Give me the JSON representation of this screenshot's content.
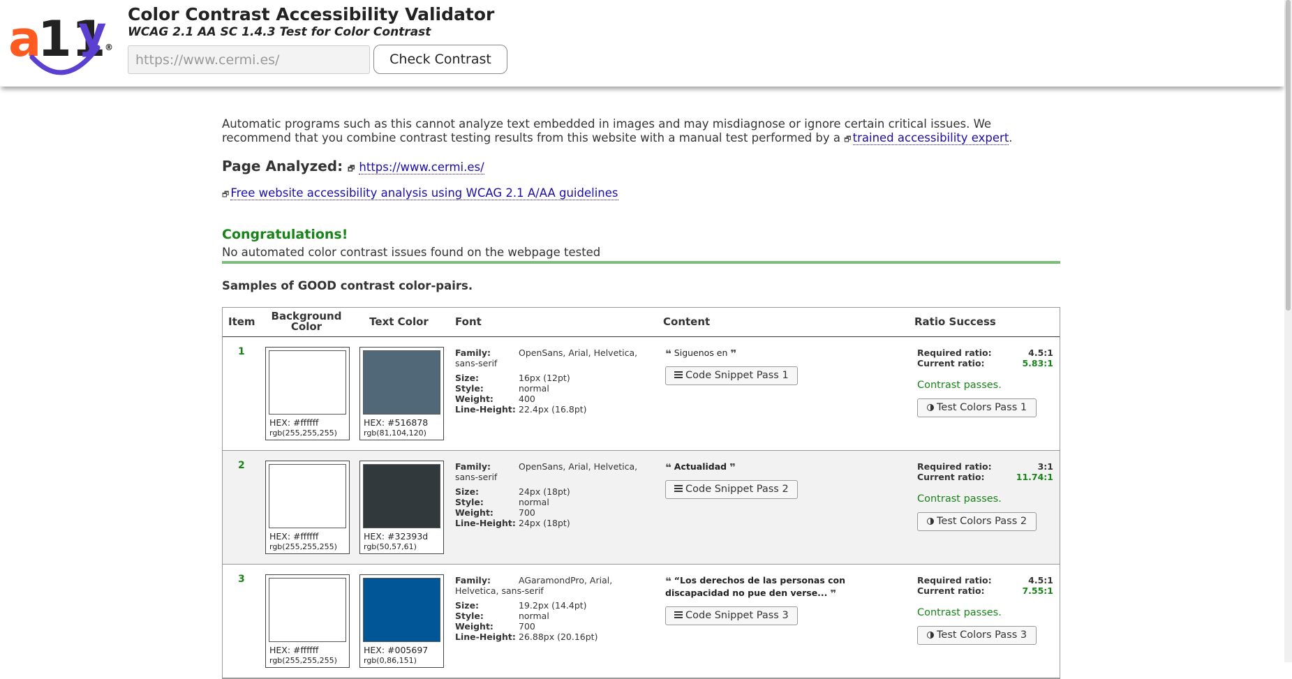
{
  "header": {
    "logo_text": "a11y",
    "logo_mark": "®",
    "title": "Color Contrast Accessibility Validator",
    "subtitle": "WCAG 2.1 AA SC 1.4.3 Test for Color Contrast",
    "url_placeholder": "https://www.cermi.es/",
    "check_button": "Check Contrast"
  },
  "notice": {
    "text": "Automatic programs such as this cannot analyze text embedded in images and may misdiagnose or ignore certain critical issues. We recommend that you combine contrast testing results from this website with a manual test performed by a ",
    "expert_link": "trained accessibility expert",
    "end": "."
  },
  "page_analyzed": {
    "label": "Page Analyzed:",
    "url": "https://www.cermi.es/"
  },
  "free_analysis_link": "Free website accessibility analysis using WCAG 2.1 A/AA guidelines",
  "result": {
    "congrats": "Congratulations!",
    "message": "No automated color contrast issues found on the webpage tested"
  },
  "samples_title": "Samples of GOOD contrast color-pairs.",
  "table": {
    "headers": {
      "item": "Item",
      "background": "Background Color",
      "text_color": "Text Color",
      "font": "Font",
      "content": "Content",
      "ratio": "Ratio Success"
    },
    "labels": {
      "family": "Family:",
      "size": "Size:",
      "style": "Style:",
      "weight": "Weight:",
      "line_height": "Line-Height:",
      "required": "Required ratio:",
      "current": "Current ratio:"
    },
    "rows": [
      {
        "item": "1",
        "bg_hex": "HEX: #ffffff",
        "bg_rgb": "rgb(255,255,255)",
        "bg_color": "#ffffff",
        "fg_hex": "HEX: #516878",
        "fg_rgb": "rgb(81,104,120)",
        "fg_color": "#516878",
        "family": "OpenSans, Arial, Helvetica, sans-serif",
        "size": "16px (12pt)",
        "style": "normal",
        "weight": "400",
        "line_height": "22.4px (16.8pt)",
        "content": "Siguenos en",
        "content_bold": false,
        "snippet_button": "Code Snippet Pass 1",
        "required": "4.5:1",
        "current": "5.83:1",
        "passes": "Contrast passes.",
        "test_button": "Test Colors Pass 1"
      },
      {
        "item": "2",
        "bg_hex": "HEX: #ffffff",
        "bg_rgb": "rgb(255,255,255)",
        "bg_color": "#ffffff",
        "fg_hex": "HEX: #32393d",
        "fg_rgb": "rgb(50,57,61)",
        "fg_color": "#32393d",
        "family": "OpenSans, Arial, Helvetica, sans-serif",
        "size": "24px (18pt)",
        "style": "normal",
        "weight": "700",
        "line_height": "24px (18pt)",
        "content": "Actualidad",
        "content_bold": true,
        "snippet_button": "Code Snippet Pass 2",
        "required": "3:1",
        "current": "11.74:1",
        "passes": "Contrast passes.",
        "test_button": "Test Colors Pass 2"
      },
      {
        "item": "3",
        "bg_hex": "HEX: #ffffff",
        "bg_rgb": "rgb(255,255,255)",
        "bg_color": "#ffffff",
        "fg_hex": "HEX: #005697",
        "fg_rgb": "rgb(0,86,151)",
        "fg_color": "#005697",
        "family": "AGaramondPro, Arial, Helvetica, sans-serif",
        "size": "19.2px (14.4pt)",
        "style": "normal",
        "weight": "700",
        "line_height": "26.88px (20.16pt)",
        "content": "“Los derechos de las personas con discapacidad no pue den verse...",
        "content_bold": true,
        "snippet_button": "Code Snippet Pass 3",
        "required": "4.5:1",
        "current": "7.55:1",
        "passes": "Contrast passes.",
        "test_button": "Test Colors Pass 3"
      }
    ]
  },
  "colors": {
    "logo_orange": "#ff5a1f",
    "logo_purple": "#5a3fd1",
    "success_green": "#188418",
    "link_blue": "#1a0dab"
  }
}
